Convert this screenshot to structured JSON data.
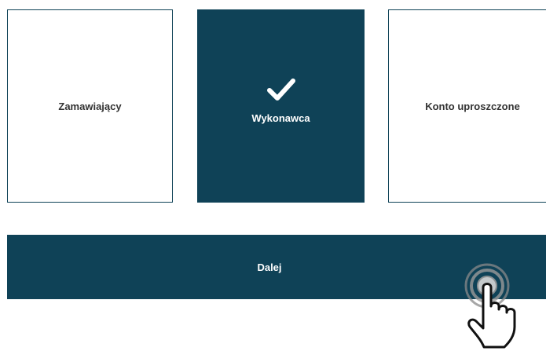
{
  "options": [
    {
      "label": "Zamawiający",
      "selected": false
    },
    {
      "label": "Wykonawca",
      "selected": true
    },
    {
      "label": "Konto uproszczone",
      "selected": false
    }
  ],
  "next_button": {
    "label": "Dalej"
  },
  "icons": {
    "selected_marker": "check-icon",
    "cursor": "hand-pointer-icon"
  },
  "colors": {
    "primary": "#0f4257",
    "text_dark": "#333333",
    "text_light": "#ffffff",
    "cursor_ripple": "#7a7a7a"
  }
}
